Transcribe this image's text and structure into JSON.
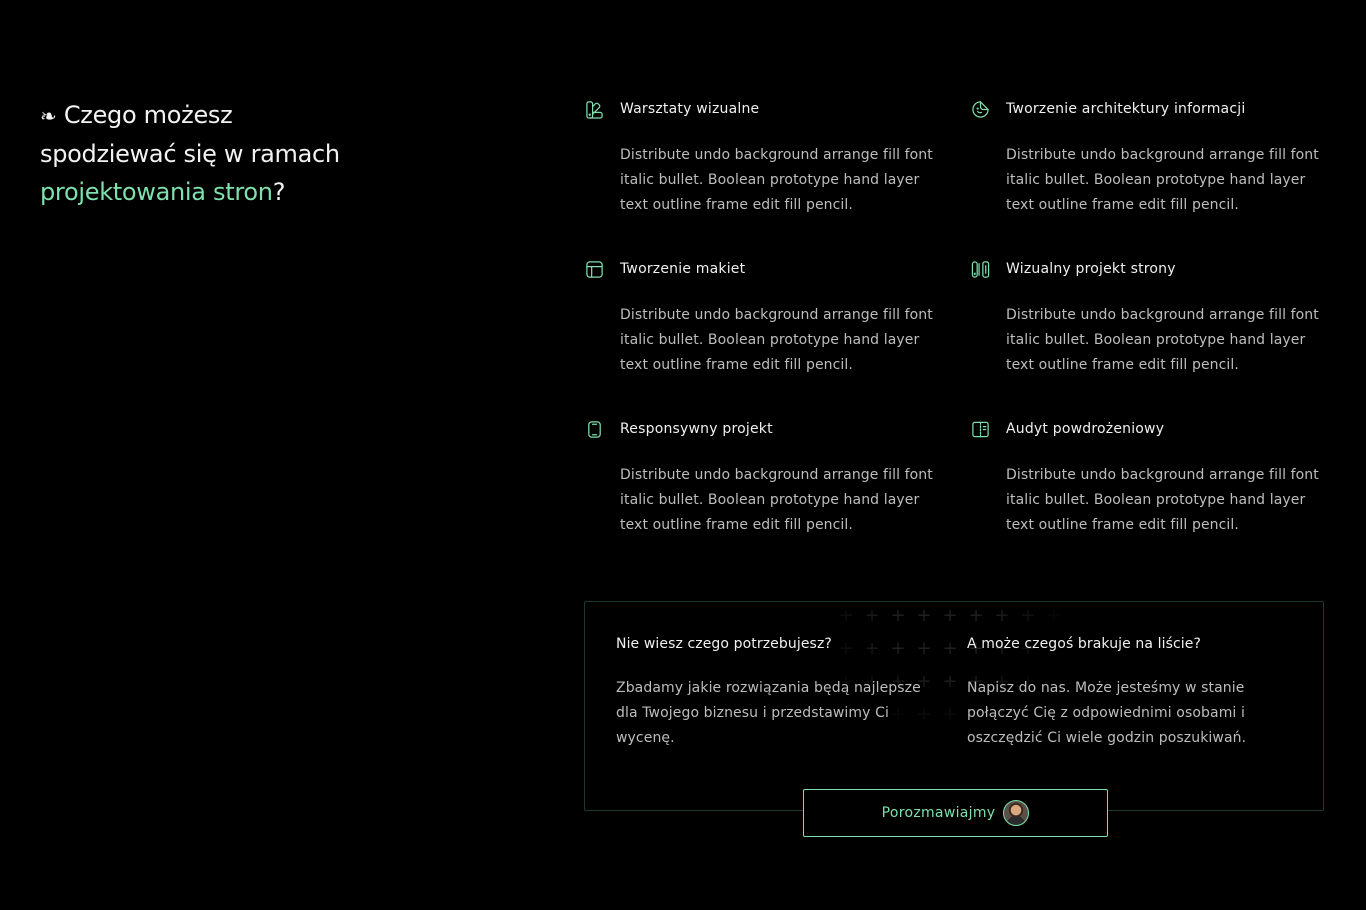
{
  "heading": {
    "icon": "❧",
    "line1": "Czego możesz",
    "line2": "spodziewać się w ramach",
    "accent": "projektowania stron",
    "suffix": "?"
  },
  "colors": {
    "accent": "#7ee0ad",
    "background": "#000000",
    "text": "#f0f0f0",
    "muted": "#bdbdbd",
    "border": "#1c3a2c"
  },
  "services": [
    {
      "icon": "palette-icon",
      "title": "Warsztaty wizualne",
      "description": "Distribute undo background arrange fill font italic bullet. Boolean prototype hand layer text outline frame edit fill pencil."
    },
    {
      "icon": "sticker-icon",
      "title": "Tworzenie architektury informacji",
      "description": "Distribute undo background arrange fill font italic bullet. Boolean prototype hand layer text outline frame edit fill pencil."
    },
    {
      "icon": "layout-icon",
      "title": "Tworzenie makiet",
      "description": "Distribute undo background arrange fill font italic bullet. Boolean prototype hand layer text outline frame edit fill pencil."
    },
    {
      "icon": "swatches-icon",
      "title": "Wizualny projekt strony",
      "description": "Distribute undo background arrange fill font italic bullet. Boolean prototype hand layer text outline frame edit fill pencil."
    },
    {
      "icon": "mobile-icon",
      "title": "Responsywny projekt",
      "description": "Distribute undo background arrange fill font italic bullet. Boolean prototype hand layer text outline frame edit fill pencil."
    },
    {
      "icon": "split-panel-icon",
      "title": "Audyt powdrożeniowy",
      "description": "Distribute undo background arrange fill font italic bullet. Boolean prototype hand layer text outline frame edit fill pencil."
    }
  ],
  "cta": {
    "left": {
      "title": "Nie wiesz czego potrzebujesz?",
      "text": "Zbadamy jakie rozwiązania będą najlepsze dla Twojego biznesu i przedstawimy Ci wycenę."
    },
    "right": {
      "title": "A może czegoś brakuje na liście?",
      "text": "Napisz do nas. Może jesteśmy w stanie połączyć Cię z odpowiednimi osobami i oszczędzić Ci wiele godzin poszukiwań."
    },
    "button_label": "Porozmawiajmy"
  }
}
